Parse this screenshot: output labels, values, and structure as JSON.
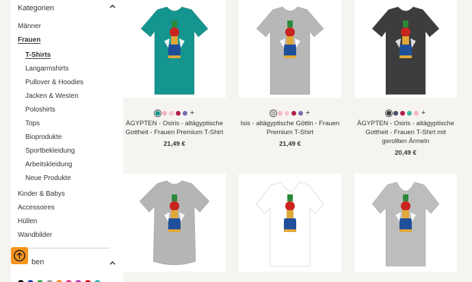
{
  "sidebar": {
    "categories_title": "Kategorien",
    "items": [
      {
        "label": "Männer"
      },
      {
        "label": "Frauen"
      },
      {
        "label": "T-Shirts"
      },
      {
        "label": "Langarmshirts"
      },
      {
        "label": "Pullover & Hoodies"
      },
      {
        "label": "Jacken & Westen"
      },
      {
        "label": "Poloshirts"
      },
      {
        "label": "Tops"
      },
      {
        "label": "Bioprodukte"
      },
      {
        "label": "Sportbekleidung"
      },
      {
        "label": "Arbeitskleidung"
      },
      {
        "label": "Neue Produkte"
      },
      {
        "label": "Kinder & Babys"
      },
      {
        "label": "Accessoires"
      },
      {
        "label": "Hüllen"
      },
      {
        "label": "Wandbilder"
      }
    ],
    "colors_title": "ben",
    "color_swatches": [
      "#111111",
      "#1f3fa8",
      "#2aa84a",
      "#9a9a9a",
      "#f08a1c",
      "#e0398a",
      "#b23ab5",
      "#d61f1f",
      "#2bb5b0"
    ]
  },
  "products": [
    {
      "title": "ÄGYPTEN - Osiris - altägyptische Gottheit - Frauen Premium T-Shirt",
      "price": "21,49 €",
      "shirt_color": "#14958f",
      "style": "tee",
      "swatches": [
        "#14958f",
        "#f2b8c6",
        "#f4c7cf",
        "#b2204a",
        "#7b6fb0"
      ]
    },
    {
      "title": "Isis - altägyptische Göttin - Frauen Premium T-Shirt",
      "price": "21,49 €",
      "shirt_color": "#b7b7b7",
      "style": "tee",
      "swatches": [
        "#b7b7b7",
        "#f2b8c6",
        "#f4c7cf",
        "#b2204a",
        "#7b6fb0"
      ]
    },
    {
      "title": "ÄGYPTEN - Osiris - altägyptische Gottheit - Frauen T-Shirt mit gerollten Ärmeln",
      "price": "20,49 €",
      "shirt_color": "#3d3d3d",
      "style": "tee",
      "swatches": [
        "#3d3d3d",
        "#4a4f6a",
        "#b2204a",
        "#3fb7a8",
        "#f2b8c6"
      ]
    },
    {
      "title": "",
      "price": "",
      "shirt_color": "#b5b5b5",
      "style": "rolled",
      "swatches": []
    },
    {
      "title": "",
      "price": "",
      "shirt_color": "#ffffff",
      "style": "vneck",
      "swatches": []
    },
    {
      "title": "",
      "price": "",
      "shirt_color": "#bdbdbd",
      "style": "vneck",
      "swatches": []
    }
  ]
}
